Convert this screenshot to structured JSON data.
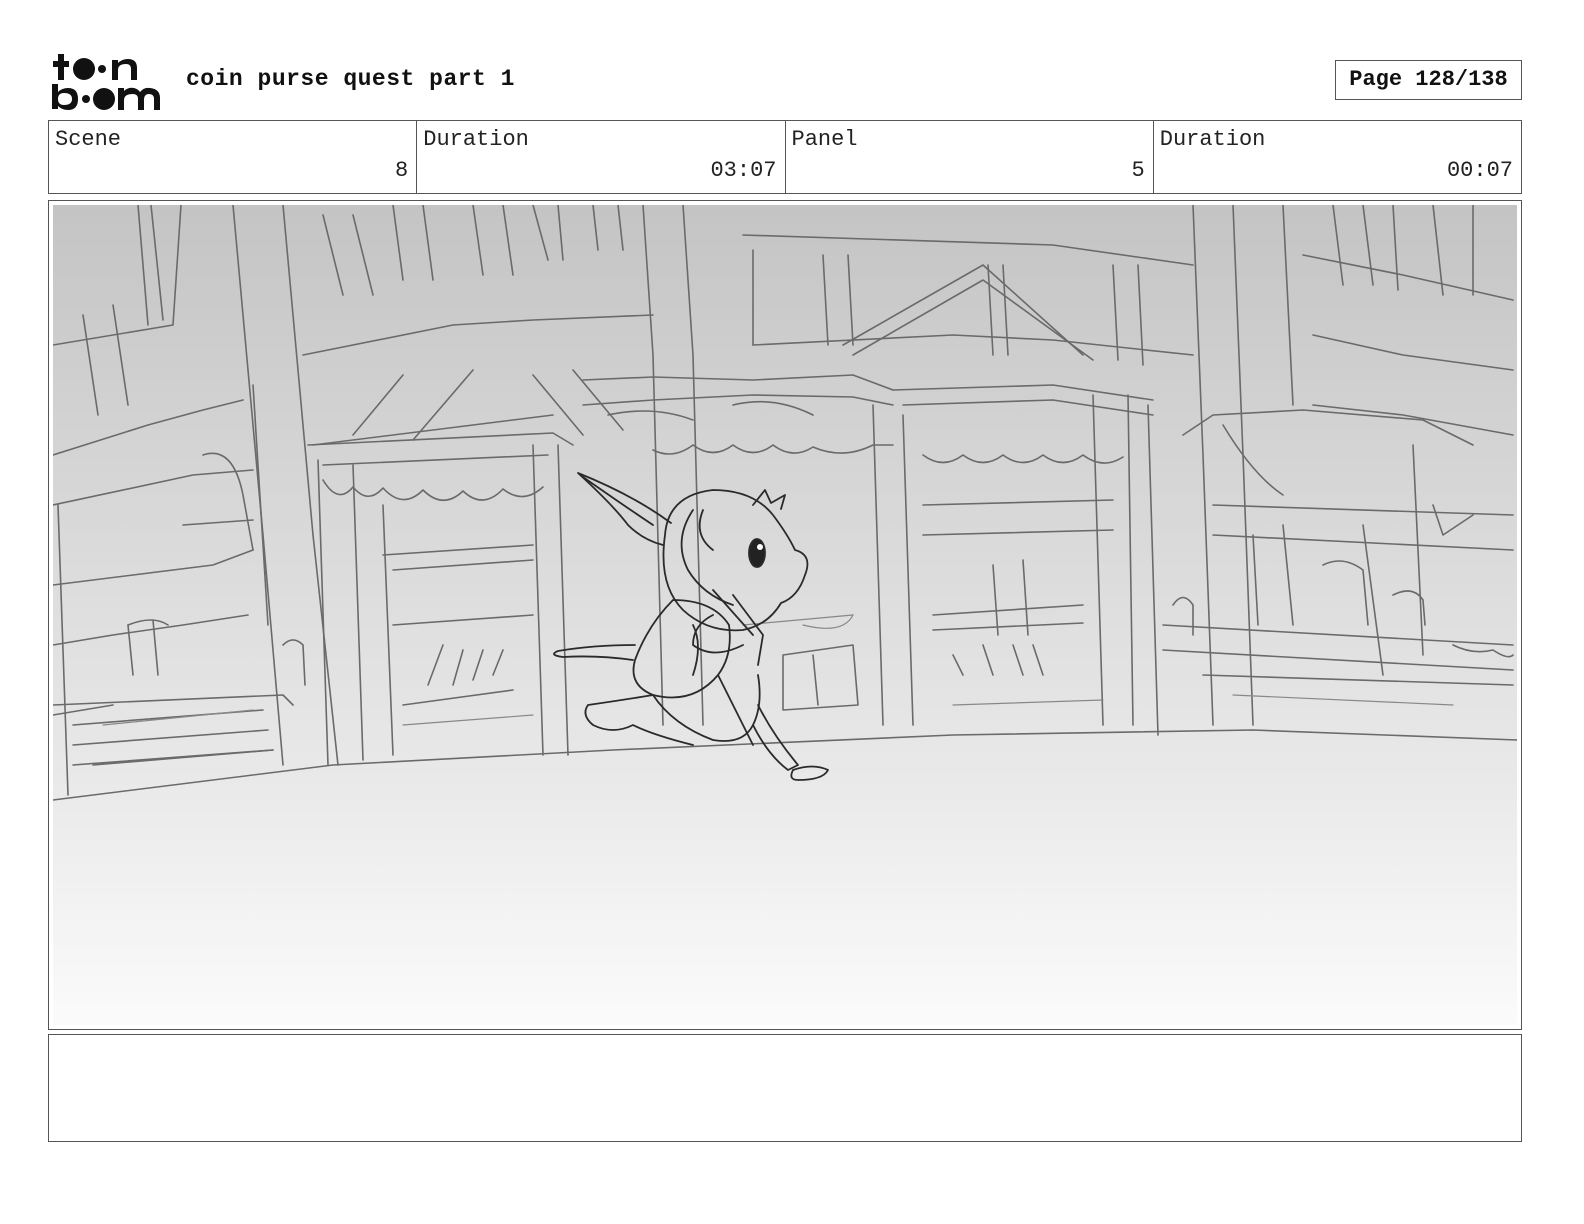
{
  "header": {
    "logo_text": "toon boom",
    "title": "coin purse quest part 1",
    "page": "Page 128/138"
  },
  "info": {
    "scene_label": "Scene",
    "scene_value": "8",
    "scene_duration_label": "Duration",
    "scene_duration_value": "03:07",
    "panel_label": "Panel",
    "panel_value": "5",
    "panel_duration_label": "Duration",
    "panel_duration_value": "00:07"
  },
  "notes": {
    "text": ""
  }
}
